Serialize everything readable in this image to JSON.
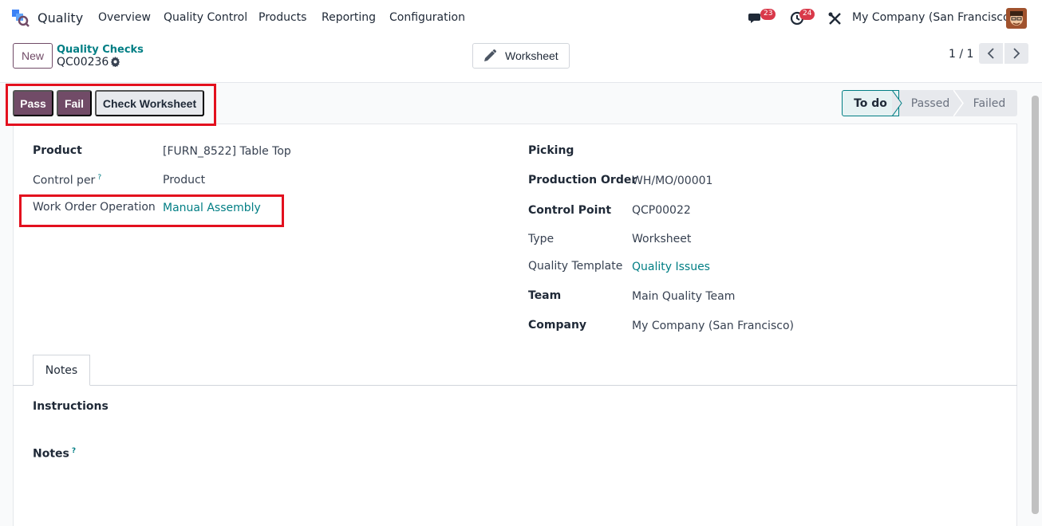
{
  "navbar": {
    "app_name": "Quality",
    "menu": [
      "Overview",
      "Quality Control",
      "Products",
      "Reporting",
      "Configuration"
    ],
    "messages_count": "23",
    "activities_count": "24",
    "company": "My Company (San Francisco)"
  },
  "control_panel": {
    "new_label": "New",
    "breadcrumb": "Quality Checks",
    "record_name": "QC00236",
    "worksheet_label": "Worksheet",
    "pager": "1 / 1"
  },
  "actions": {
    "pass": "Pass",
    "fail": "Fail",
    "check_worksheet": "Check Worksheet"
  },
  "statusbar": {
    "stages": [
      "To do",
      "Passed",
      "Failed"
    ],
    "active": "To do"
  },
  "form": {
    "left": {
      "product_label": "Product",
      "product_value": "[FURN_8522] Table Top",
      "control_per_label": "Control per",
      "control_per_help": "?",
      "control_per_value": "Product",
      "work_order_label": "Work Order Operation",
      "work_order_value": "Manual Assembly"
    },
    "right": {
      "picking_label": "Picking",
      "production_order_label": "Production Order",
      "production_order_value": "WH/MO/00001",
      "control_point_label": "Control Point",
      "control_point_value": "QCP00022",
      "type_label": "Type",
      "type_value": "Worksheet",
      "quality_template_label": "Quality Template",
      "quality_template_value": "Quality Issues",
      "team_label": "Team",
      "team_value": "Main Quality Team",
      "company_label": "Company",
      "company_value": "My Company (San Francisco)"
    }
  },
  "notebook": {
    "tab": "Notes",
    "instructions_label": "Instructions",
    "notes_label": "Notes",
    "notes_help": "?"
  },
  "colors": {
    "primary": "#714b67",
    "link": "#017e84",
    "highlight": "#e3101e",
    "badge": "#d9394a"
  }
}
